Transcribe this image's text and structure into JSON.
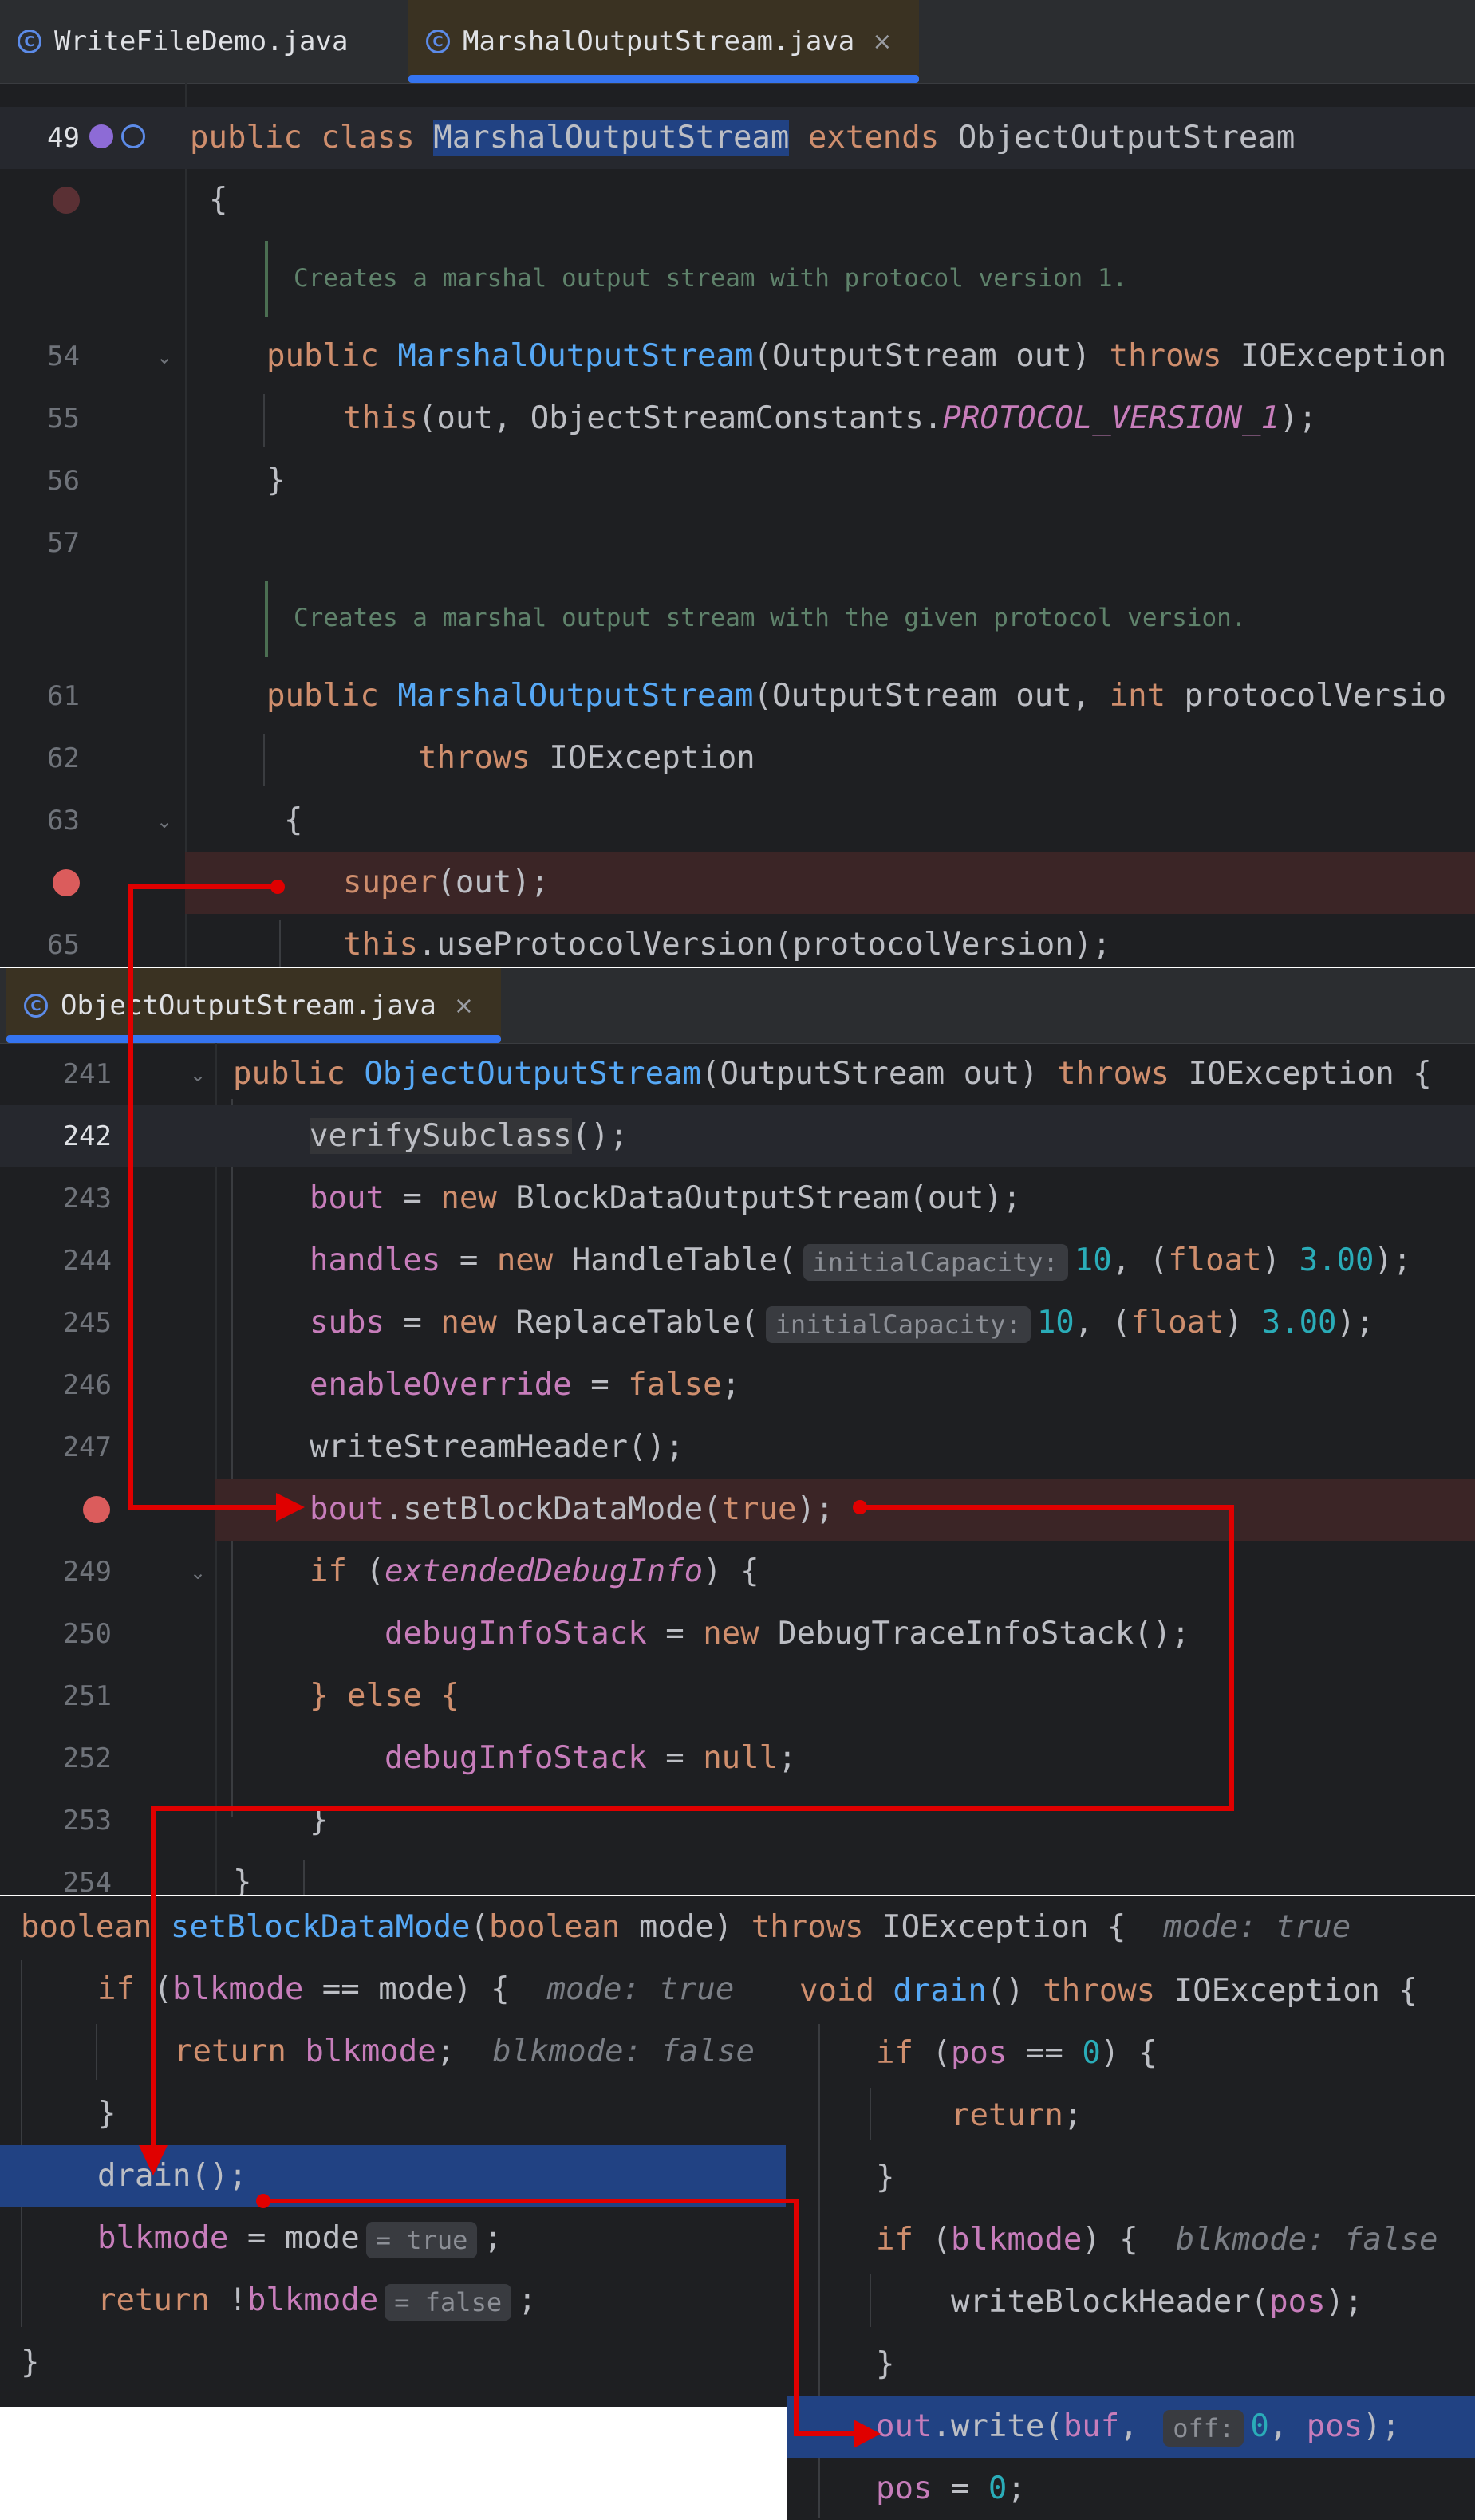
{
  "panel1": {
    "tabs": [
      {
        "label": "WriteFileDemo.java",
        "icon": "java-class-icon",
        "active": false
      },
      {
        "label": "MarshalOutputStream.java",
        "icon": "java-class-icon",
        "active": true,
        "close": "×"
      }
    ],
    "lines": {
      "l49": "49",
      "l54": "54",
      "l55": "55",
      "l56": "56",
      "l57": "57",
      "l61": "61",
      "l62": "62",
      "l63": "63",
      "l65": "65"
    },
    "code": {
      "public": "public",
      "class": "class",
      "class_name": "MarshalOutputStream",
      "extends": "extends",
      "parent": "ObjectOutputStream",
      "open_brace": "{",
      "doc1": "Creates a marshal output stream with protocol version 1.",
      "ctor1_name": "MarshalOutputStream",
      "ctor1_params": "(OutputStream out) ",
      "throws": "throws",
      "ioexc": " IOException",
      "this_kw": "this",
      "this_args_a": "(out, ObjectStreamConstants.",
      "proto_const": "PROTOCOL_VERSION_1",
      "this_args_b": ");",
      "close_brace": "}",
      "doc2": "Creates a marshal output stream with the given protocol version.",
      "ctor2_name": "MarshalOutputStream",
      "ctor2_params_a": "(OutputStream out, ",
      "int_kw": "int",
      "ctor2_params_b": " protocolVersio",
      "throws2": "throws",
      "ioexc2": " IOException",
      "super_kw": "super",
      "super_args": "(out);",
      "use_proto": ".useProtocolVersion(protocolVersion);"
    }
  },
  "panel2": {
    "tab": {
      "label": "ObjectOutputStream.java",
      "icon": "java-class-icon",
      "close": "×"
    },
    "lines": {
      "l241": "241",
      "l242": "242",
      "l243": "243",
      "l244": "244",
      "l245": "245",
      "l246": "246",
      "l247": "247",
      "l249": "249",
      "l250": "250",
      "l251": "251",
      "l252": "252",
      "l253": "253",
      "l254": "254"
    },
    "code": {
      "public": "public",
      "ctor_name": "ObjectOutputStream",
      "ctor_params": "(OutputStream out) ",
      "throws": "throws",
      "ioexc_brace": " IOException {",
      "verify": "verifySubclass",
      "verify_tail": "();",
      "bout": "bout",
      "eq": " = ",
      "new": "new",
      "bdos": " BlockDataOutputStream(out);",
      "handles": "handles",
      "handle_table": " HandleTable(",
      "hint_cap": "initialCapacity:",
      "ten": "10",
      "comma_sp": ", (",
      "float_kw": "float",
      "paren_sp": ") ",
      "three": "3.00",
      "end_paren": ");",
      "subs": "subs",
      "replace_table": " ReplaceTable(",
      "enable": "enableOverride",
      "false_kw": "false",
      "semi": ";",
      "write_header": "writeStreamHeader();",
      "set_block": ".setBlockDataMode(",
      "true_kw": "true",
      "close_semi": ");",
      "if_kw": "if",
      "paren_open": " (",
      "ext_debug": "extendedDebugInfo",
      "paren_close_brace": ") {",
      "debug_stack": "debugInfoStack",
      "dtis": " DebugTraceInfoStack();",
      "else": "} else {",
      "null_kw": "null",
      "close_brace": "}"
    }
  },
  "panel3": {
    "code": {
      "boolean": "boolean",
      "method": "setBlockDataMode",
      "params_open": "(",
      "param_type": "boolean",
      "param_name": " mode) ",
      "throws": "throws",
      "ioexc": " IOException {",
      "hint_mode_true": "mode: true",
      "if_kw": "if",
      "paren": " (",
      "blkmode": "blkmode",
      "eq_mode": " == mode) {",
      "return_kw": "return",
      "semi": ";",
      "hint_blk_false": "blkmode: false",
      "close_brace": "}",
      "drain_call": "drain();",
      "assign": " = mode",
      "hint_eq_true": "= true",
      "not": " !",
      "hint_eq_false": "= false"
    }
  },
  "panel4": {
    "code": {
      "void": "void",
      "method": "drain",
      "sig_tail": "() ",
      "throws": "throws",
      "ioexc": " IOException {",
      "if_kw": "if",
      "paren": " (",
      "pos": "pos",
      "eq0": " == ",
      "zero": "0",
      "close": ") {",
      "return_kw": "return",
      "semi": ";",
      "close_brace": "}",
      "blkmode": "blkmode",
      "close_paren": ") {",
      "hint_blk_false": "blkmode: false",
      "wbh": "writeBlockHeader(",
      "end": ");",
      "out": "out",
      "write": ".write(",
      "buf": "buf",
      "comma": ", ",
      "hint_off": "off:",
      "end_paren": ");",
      "assign0": " = "
    }
  },
  "colors": {
    "background": "#1e1f22",
    "keyword": "#cf8e6d",
    "function": "#56a8f5",
    "field": "#c77dbb",
    "number": "#2aacb8",
    "breakpoint": "#db5c5c",
    "selection": "#214283",
    "arrow": "#e00000"
  }
}
